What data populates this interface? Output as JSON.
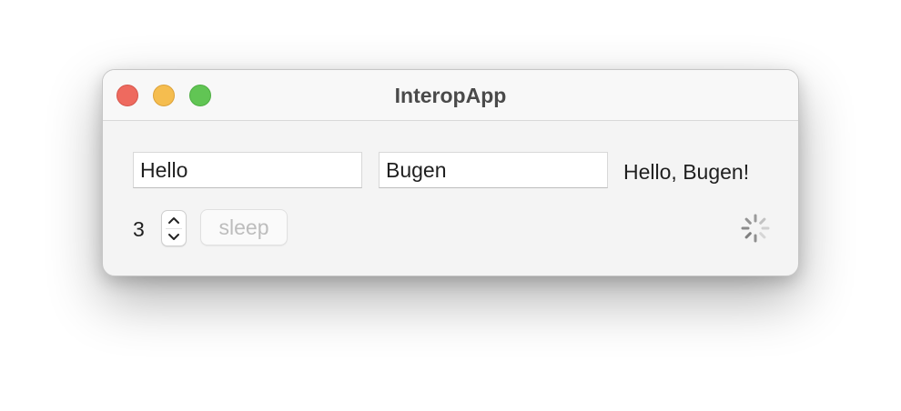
{
  "window": {
    "title": "InteropApp"
  },
  "form": {
    "first_field_value": "Hello",
    "second_field_value": "Bugen",
    "greeting_text": "Hello, Bugen!",
    "count_value": "3",
    "sleep_label": "sleep",
    "sleep_enabled": false
  },
  "icons": {
    "stepper_up": "chevron-up-icon",
    "stepper_down": "chevron-down-icon",
    "activity": "spinner-icon"
  },
  "colors": {
    "close": "#ee6a5f",
    "minimize": "#f5bd4f",
    "zoom": "#61c554",
    "window_bg": "#f4f4f4",
    "disabled_text": "#bdbdbd"
  }
}
